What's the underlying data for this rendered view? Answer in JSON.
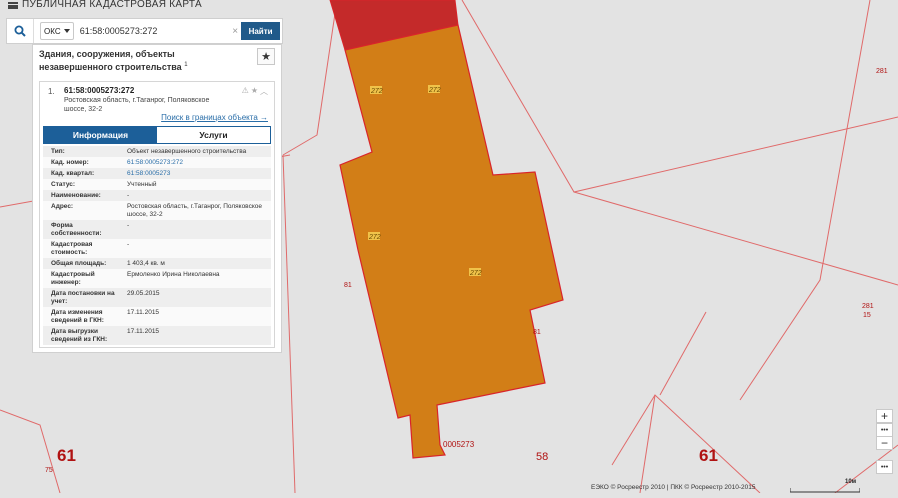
{
  "app": {
    "title": "ПУБЛИЧНАЯ КАДАСТРОВАЯ КАРТА"
  },
  "search": {
    "type": "ОКС",
    "value": "61:58:0005273:272",
    "clear_symbol": "×",
    "button": "Найти"
  },
  "panel": {
    "heading": "Здания, сооружения, объекты незавершенного строительства",
    "heading_count": "1",
    "item": {
      "number": "1.",
      "cadnum": "61:58:0005273:272",
      "address": "Ростовская область, г.Таганрог, Поляковское шоссе, 32-2",
      "search_link": "Поиск в границах объекта →"
    },
    "tabs": [
      "Информация",
      "Услуги"
    ],
    "attributes": [
      {
        "key": "Тип:",
        "value": "Объект незавершенного строительства"
      },
      {
        "key": "Кад. номер:",
        "value": "61:58:0005273:272",
        "link": true
      },
      {
        "key": "Кад. квартал:",
        "value": "61:58:0005273",
        "link": true
      },
      {
        "key": "Статус:",
        "value": "Учтенный"
      },
      {
        "key": "Наименование:",
        "value": "-"
      },
      {
        "key": "Адрес:",
        "value": "Ростовская область, г.Таганрог, Поляковское шоссе, 32-2"
      },
      {
        "key": "Форма собственности:",
        "value": "-"
      },
      {
        "key": "Кадастровая стоимость:",
        "value": "-"
      },
      {
        "key": "Общая площадь:",
        "value": "1 403,4 кв. м"
      },
      {
        "key": "Кадастровый инженер:",
        "value": "Ермоленко Ирина Николаевна"
      },
      {
        "key": "Дата постановки на учет:",
        "value": "29.05.2015"
      },
      {
        "key": "Дата изменения сведений в ГКН:",
        "value": "17.11.2015"
      },
      {
        "key": "Дата выгрузки сведений из ГКН:",
        "value": "17.11.2015"
      }
    ]
  },
  "map": {
    "labels": {
      "district_left": "61",
      "district_right": "61",
      "quarter_58": "58",
      "parcel_75": "75",
      "parcel_281_top": "281",
      "parcel_281_right": "281",
      "parcel_15": "15",
      "parcel_81_left": "81",
      "parcel_81_right": "81",
      "quarter_code": "0005273",
      "building_tags": [
        "272",
        "272",
        "272",
        "272"
      ]
    },
    "colors": {
      "building_fill": "#d27e17",
      "building_stroke": "#d9242a",
      "red_block": "#c42a2a",
      "background": "#e3e3e3",
      "boundary": "#e06a6a"
    }
  },
  "controls": {
    "zoom_in": "+",
    "more_1": "•••",
    "zoom_out": "−",
    "more_2": "•••"
  },
  "footer": {
    "attribution": "ЕЭКО © Росреестр 2010 | ПКК © Росреестр 2010-2015",
    "scale_label": "10м"
  }
}
